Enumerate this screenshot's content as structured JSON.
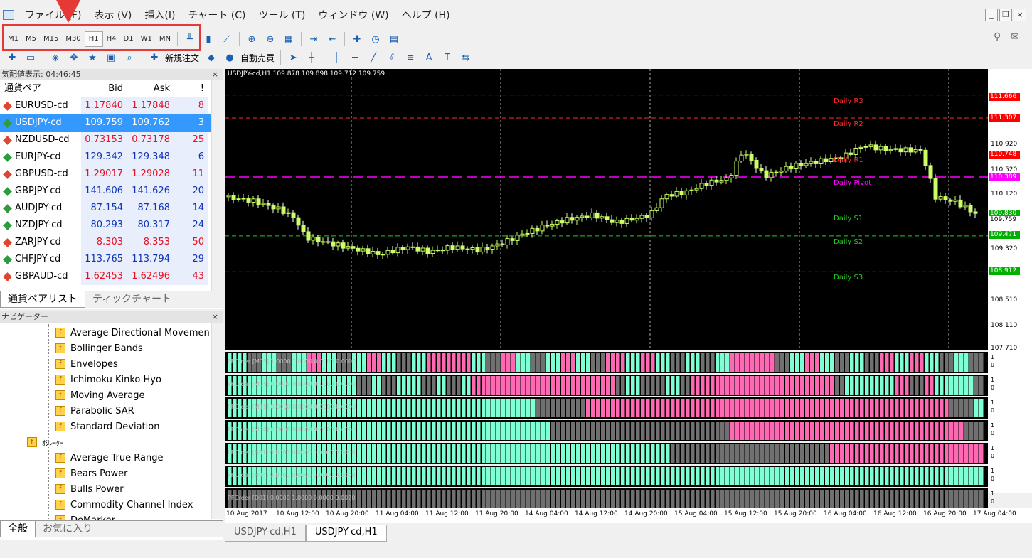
{
  "menubar": {
    "items": [
      "ファイル (F)",
      "表示 (V)",
      "挿入(I)",
      "チャート (C)",
      "ツール (T)",
      "ウィンドウ (W)",
      "ヘルプ (H)"
    ]
  },
  "window_buttons": [
    "_",
    "❐",
    "×"
  ],
  "toolbar1": {
    "timeframes": [
      "M1",
      "M5",
      "M15",
      "M30",
      "H1",
      "H4",
      "D1",
      "W1",
      "MN"
    ],
    "active_timeframe": "H1"
  },
  "toolbar2": {
    "new_order_label": "新規注文",
    "auto_trade_label": "自動売買"
  },
  "market_watch": {
    "title": "気配値表示: 04:46:45",
    "headers": {
      "symbol": "通貨ペア",
      "bid": "Bid",
      "ask": "Ask",
      "spread": "!"
    },
    "rows": [
      {
        "symbol": "EURUSD-cd",
        "bid": "1.17840",
        "ask": "1.17848",
        "spread": "8",
        "dir": "down",
        "color": "red"
      },
      {
        "symbol": "USDJPY-cd",
        "bid": "109.759",
        "ask": "109.762",
        "spread": "3",
        "dir": "up",
        "color": "selected"
      },
      {
        "symbol": "NZDUSD-cd",
        "bid": "0.73153",
        "ask": "0.73178",
        "spread": "25",
        "dir": "down",
        "color": "red"
      },
      {
        "symbol": "EURJPY-cd",
        "bid": "129.342",
        "ask": "129.348",
        "spread": "6",
        "dir": "up",
        "color": "blue"
      },
      {
        "symbol": "GBPUSD-cd",
        "bid": "1.29017",
        "ask": "1.29028",
        "spread": "11",
        "dir": "down",
        "color": "red"
      },
      {
        "symbol": "GBPJPY-cd",
        "bid": "141.606",
        "ask": "141.626",
        "spread": "20",
        "dir": "up",
        "color": "blue"
      },
      {
        "symbol": "AUDJPY-cd",
        "bid": "87.154",
        "ask": "87.168",
        "spread": "14",
        "dir": "up",
        "color": "blue"
      },
      {
        "symbol": "NZDJPY-cd",
        "bid": "80.293",
        "ask": "80.317",
        "spread": "24",
        "dir": "up",
        "color": "blue"
      },
      {
        "symbol": "ZARJPY-cd",
        "bid": "8.303",
        "ask": "8.353",
        "spread": "50",
        "dir": "down",
        "color": "red"
      },
      {
        "symbol": "CHFJPY-cd",
        "bid": "113.765",
        "ask": "113.794",
        "spread": "29",
        "dir": "up",
        "color": "blue"
      },
      {
        "symbol": "GBPAUD-cd",
        "bid": "1.62453",
        "ask": "1.62496",
        "spread": "43",
        "dir": "down",
        "color": "red"
      }
    ],
    "tabs": [
      "通貨ペアリスト",
      "ティックチャート"
    ],
    "active_tab": 0
  },
  "navigator": {
    "title": "ナビゲーター",
    "items": [
      {
        "label": "Average Directional Movemen",
        "level": 2
      },
      {
        "label": "Bollinger Bands",
        "level": 2
      },
      {
        "label": "Envelopes",
        "level": 2
      },
      {
        "label": "Ichimoku Kinko Hyo",
        "level": 2
      },
      {
        "label": "Moving Average",
        "level": 2
      },
      {
        "label": "Parabolic SAR",
        "level": 2
      },
      {
        "label": "Standard Deviation",
        "level": 2
      },
      {
        "label": "ｵｼﾚｰﾀｰ",
        "level": 1
      },
      {
        "label": "Average True Range",
        "level": 2
      },
      {
        "label": "Bears Power",
        "level": 2
      },
      {
        "label": "Bulls Power",
        "level": 2
      },
      {
        "label": "Commodity Channel Index",
        "level": 2
      },
      {
        "label": "DeMarker",
        "level": 2
      }
    ],
    "tabs": [
      "全般",
      "お気に入り"
    ],
    "active_tab": 0
  },
  "chart": {
    "title": "USDJPY-cd,H1  109.878 109.898 109.712 109.759",
    "price_labels": [
      "110.920",
      "110.520",
      "110.120",
      "109.320",
      "108.510",
      "108.110",
      "107.710"
    ],
    "price_tags": [
      {
        "text": "111.666",
        "color": "#ff0000"
      },
      {
        "text": "111.307",
        "color": "#ff0000"
      },
      {
        "text": "110.748",
        "color": "#ff0000"
      },
      {
        "text": "110.389",
        "color": "#ff00ff"
      },
      {
        "text": "109.830",
        "color": "#00b000"
      },
      {
        "text": "109.759",
        "color": "#ffffff"
      },
      {
        "text": "109.471",
        "color": "#00b000"
      },
      {
        "text": "108.912",
        "color": "#00b000"
      }
    ],
    "pivot_lines": [
      {
        "label": "Daily R3",
        "color": "#ff2a2a"
      },
      {
        "label": "Daily R2",
        "color": "#ff2a2a"
      },
      {
        "label": "Daily R1",
        "color": "#ff2a2a"
      },
      {
        "label": "Daily Pivot",
        "color": "#ff00ff"
      },
      {
        "label": "Daily S1",
        "color": "#22cc22"
      },
      {
        "label": "Daily S2",
        "color": "#22cc22"
      },
      {
        "label": "Daily S3",
        "color": "#22cc22"
      }
    ],
    "indicator_panes": [
      {
        "label": "PFOrder [M05] 1.0000 1.0000 0.0000 0.0000"
      },
      {
        "label": "PFOrder [M05] 0.0000 0.0000 0.0000 0.0000"
      },
      {
        "label": "PFOrder [M15] 0.0000 0.0000 0.0000 0.0000"
      },
      {
        "label": "PFOrder [M30] 0.0000 0.0000 0.0000 0.0000"
      },
      {
        "label": "PFOrder [H01] 0.0000 0.0000 0.0000 0.0000"
      },
      {
        "label": "PFOrder [H04] 0.0000 0.0000 0.0000 0.0000"
      },
      {
        "label": "PFOrder [D01] 0.0000 1.0000 0.0000 0.0020"
      }
    ],
    "indicator_axis": {
      "top": "1",
      "bottom": "0"
    },
    "time_labels": [
      "10 Aug 2017",
      "10 Aug 12:00",
      "10 Aug 20:00",
      "11 Aug 04:00",
      "11 Aug 12:00",
      "11 Aug 20:00",
      "14 Aug 04:00",
      "14 Aug 12:00",
      "14 Aug 20:00",
      "15 Aug 04:00",
      "15 Aug 12:00",
      "15 Aug 20:00",
      "16 Aug 04:00",
      "16 Aug 12:00",
      "16 Aug 20:00",
      "17 Aug 04:00"
    ],
    "tabs": [
      "USDJPY-cd,H1",
      "USDJPY-cd,H1"
    ],
    "active_tab": 1,
    "colors": {
      "cyan": "#7fffd4",
      "pink": "#ff69b4",
      "gray": "#707070"
    }
  }
}
